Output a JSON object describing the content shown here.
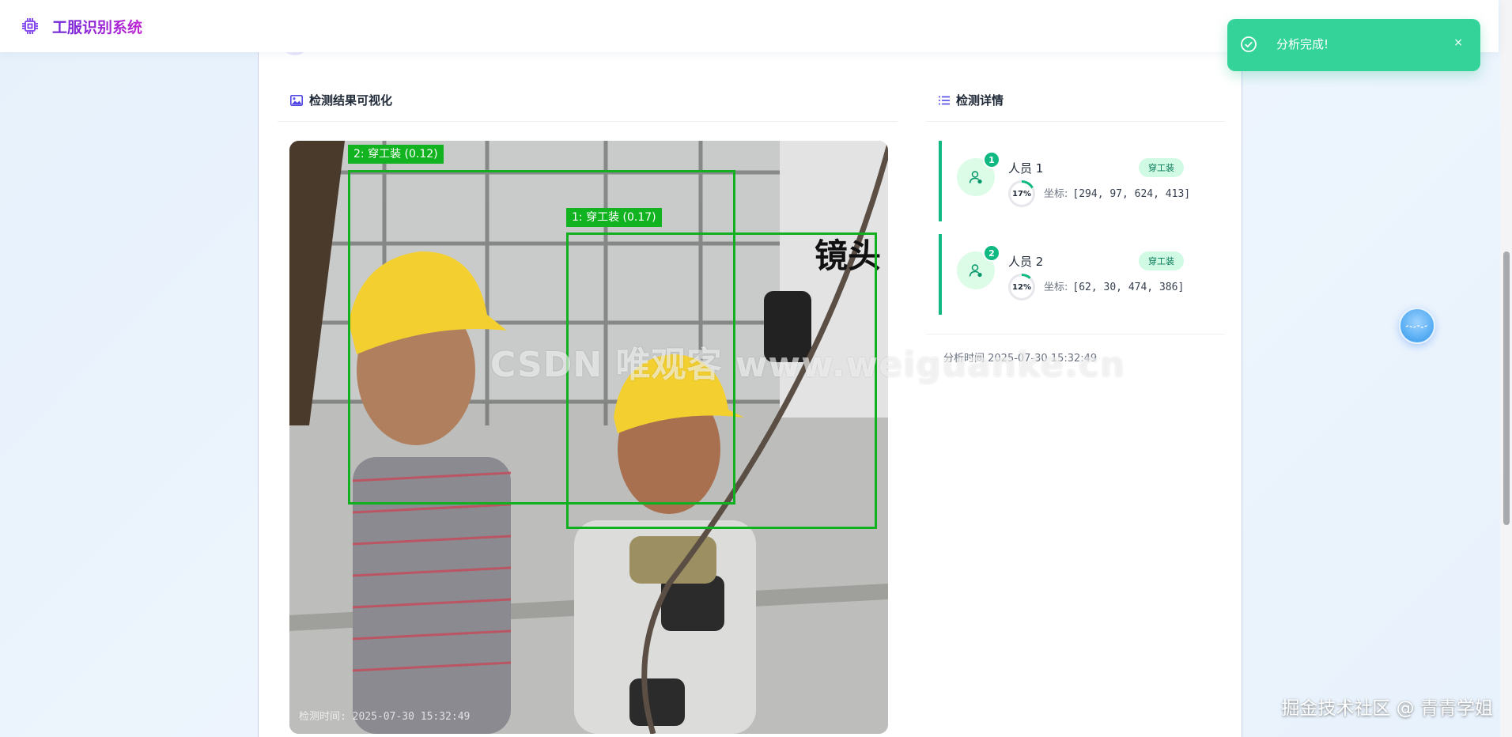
{
  "app": {
    "title": "工服识别系统",
    "icon": "chip-icon"
  },
  "main": {
    "section_title": ""
  },
  "visualization": {
    "title": "检测结果可视化",
    "icon": "image-icon",
    "boxes": [
      {
        "label": "2: 穿工装 (0.12)"
      },
      {
        "label": "1: 穿工装 (0.17)"
      }
    ],
    "scene_text": "镜头",
    "timestamp": "检测时间: 2025-07-30 15:32:49"
  },
  "details": {
    "title": "检测详情",
    "icon": "list-icon",
    "persons": [
      {
        "index": "1",
        "name": "人员 1",
        "tag": "穿工装",
        "confidence": "17%",
        "confidence_value": 17,
        "coord_label": "坐标:",
        "coords": "[294, 97, 624, 413]"
      },
      {
        "index": "2",
        "name": "人员 2",
        "tag": "穿工装",
        "confidence": "12%",
        "confidence_value": 12,
        "coord_label": "坐标:",
        "coords": "[62, 30, 474, 386]"
      }
    ],
    "analysis_time": "分析时间 2025-07-30 15:32:49"
  },
  "toast": {
    "message": "分析完成!",
    "close": "×",
    "icon": "check-circle-icon"
  },
  "watermarks": {
    "center": "CSDN 唯观客 www.weiguanke.cn",
    "bottom": "掘金技术社区 @ 青青学姐"
  },
  "colors": {
    "accent": "#10b981",
    "brand": "#7c3aed",
    "box": "#10b020",
    "toast": "#34d399"
  }
}
